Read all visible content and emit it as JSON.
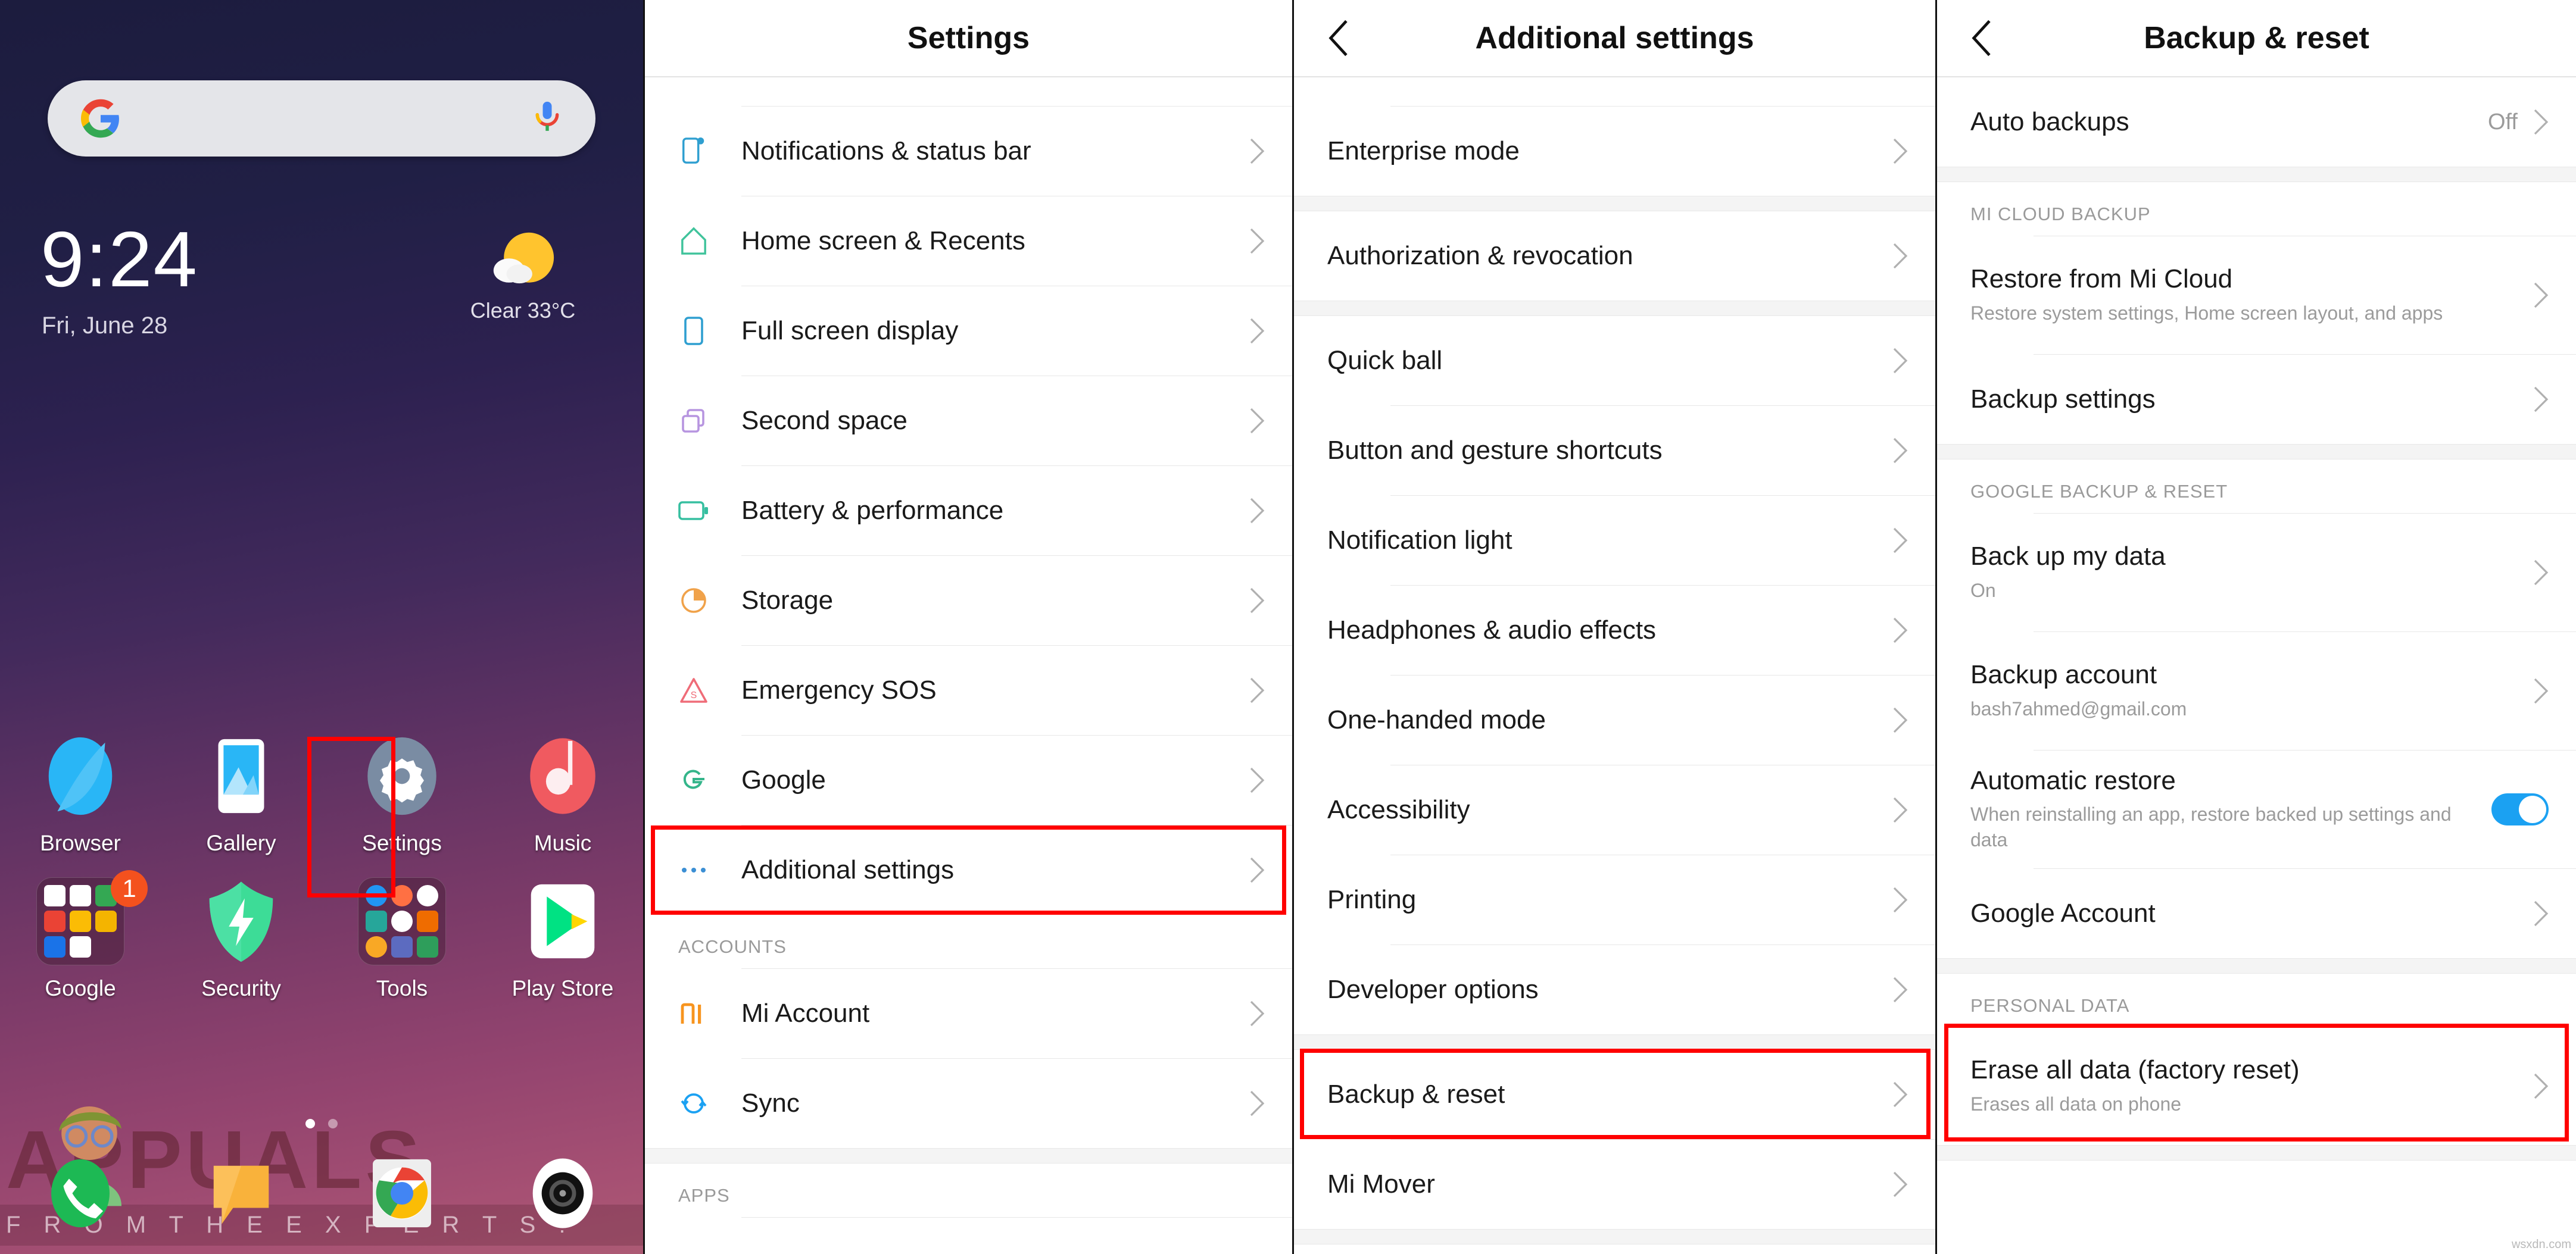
{
  "home": {
    "search": {
      "placeholder": "",
      "google_icon": "google-g-logo",
      "mic_icon": "google-mic-icon"
    },
    "clock": {
      "time": "9:24",
      "date": "Fri, June 28"
    },
    "weather": {
      "condition": "Clear",
      "temperature": "33°C",
      "condition_line": "Clear  33°C",
      "icon": "sun-behind-cloud-icon"
    },
    "apps": [
      {
        "label": "Browser",
        "icon": "browser-icon",
        "badge": ""
      },
      {
        "label": "Gallery",
        "icon": "gallery-icon",
        "badge": ""
      },
      {
        "label": "Settings",
        "icon": "settings-gear-icon",
        "badge": "",
        "highlighted": true
      },
      {
        "label": "Music",
        "icon": "music-note-icon",
        "badge": ""
      },
      {
        "label": "Google",
        "icon": "google-folder-icon",
        "badge": "1"
      },
      {
        "label": "Security",
        "icon": "security-shield-icon",
        "badge": ""
      },
      {
        "label": "Tools",
        "icon": "tools-folder-icon",
        "badge": ""
      },
      {
        "label": "Play Store",
        "icon": "play-store-icon",
        "badge": ""
      }
    ],
    "dock": [
      {
        "label": "Phone",
        "icon": "phone-icon"
      },
      {
        "label": "Messages",
        "icon": "messages-icon"
      },
      {
        "label": "Chrome",
        "icon": "chrome-icon"
      },
      {
        "label": "Camera",
        "icon": "camera-icon"
      }
    ],
    "page_indicator": {
      "total": 2,
      "current": 1
    },
    "watermark": {
      "main": "APPUALS",
      "sub": "F R O M   T H E   E X P E R T S !"
    }
  },
  "settings_panel": {
    "title": "Settings",
    "items": [
      {
        "label": "Notifications & status bar",
        "icon": "notifications-icon",
        "icon_color": "#2f9fd0"
      },
      {
        "label": "Home screen & Recents",
        "icon": "home-icon",
        "icon_color": "#3fc39b"
      },
      {
        "label": "Full screen display",
        "icon": "fullscreen-icon",
        "icon_color": "#2f9fd0"
      },
      {
        "label": "Second space",
        "icon": "second-space-icon",
        "icon_color": "#b795e0"
      },
      {
        "label": "Battery & performance",
        "icon": "battery-icon",
        "icon_color": "#36bfa0"
      },
      {
        "label": "Storage",
        "icon": "storage-icon",
        "icon_color": "#f0a24a"
      },
      {
        "label": "Emergency SOS",
        "icon": "emergency-sos-icon",
        "icon_color": "#ef6c78"
      },
      {
        "label": "Google",
        "icon": "google-g-icon",
        "icon_color": "#34b58a"
      },
      {
        "label": "Additional settings",
        "icon": "more-dots-icon",
        "icon_color": "#3b8fd4",
        "highlighted": true
      }
    ],
    "accounts_section": "ACCOUNTS",
    "accounts_items": [
      {
        "label": "Mi Account",
        "icon": "mi-logo-icon",
        "icon_color": "#f7941e"
      },
      {
        "label": "Sync",
        "icon": "sync-icon",
        "icon_color": "#1ba1f2"
      }
    ],
    "apps_section": "APPS"
  },
  "additional_panel": {
    "title": "Additional settings",
    "back_icon": "back-chevron-icon",
    "group_a": [
      {
        "label": "Enterprise mode"
      },
      {
        "label": "Authorization & revocation"
      }
    ],
    "group_b": [
      {
        "label": "Quick ball"
      },
      {
        "label": "Button and gesture shortcuts"
      },
      {
        "label": "Notification light"
      },
      {
        "label": "Headphones & audio effects"
      },
      {
        "label": "One-handed mode"
      },
      {
        "label": "Accessibility"
      },
      {
        "label": "Printing"
      },
      {
        "label": "Developer options"
      }
    ],
    "group_c": [
      {
        "label": "Backup & reset",
        "highlighted": true
      },
      {
        "label": "Mi Mover"
      }
    ]
  },
  "backup_panel": {
    "title": "Backup & reset",
    "back_icon": "back-chevron-icon",
    "auto_backups": {
      "label": "Auto backups",
      "value": "Off"
    },
    "mi_cloud_section": "MI CLOUD BACKUP",
    "mi_cloud_items": [
      {
        "label": "Restore from Mi Cloud",
        "sub": "Restore system settings, Home screen layout, and apps"
      },
      {
        "label": "Backup settings",
        "sub": ""
      }
    ],
    "google_section": "GOOGLE BACKUP & RESET",
    "google_items": [
      {
        "label": "Back up my data",
        "sub": "On",
        "type": "chevron"
      },
      {
        "label": "Backup account",
        "sub": "bash7ahmed@gmail.com",
        "type": "chevron"
      },
      {
        "label": "Automatic restore",
        "sub": "When reinstalling an app, restore backed up settings and data",
        "type": "toggle",
        "toggle_on": true
      },
      {
        "label": "Google Account",
        "sub": "",
        "type": "chevron"
      }
    ],
    "personal_section": "PERSONAL DATA",
    "personal_items": [
      {
        "label": "Erase all data (factory reset)",
        "sub": "Erases all data on phone",
        "highlighted": true
      }
    ],
    "source_watermark": "wsxdn.com"
  },
  "colors": {
    "highlight": "#ff0000",
    "toggle_on": "#1ba1f2",
    "accent_blue": "#2f9fd0",
    "text_primary": "#1a1a1a",
    "text_secondary": "#9b9b9b"
  }
}
